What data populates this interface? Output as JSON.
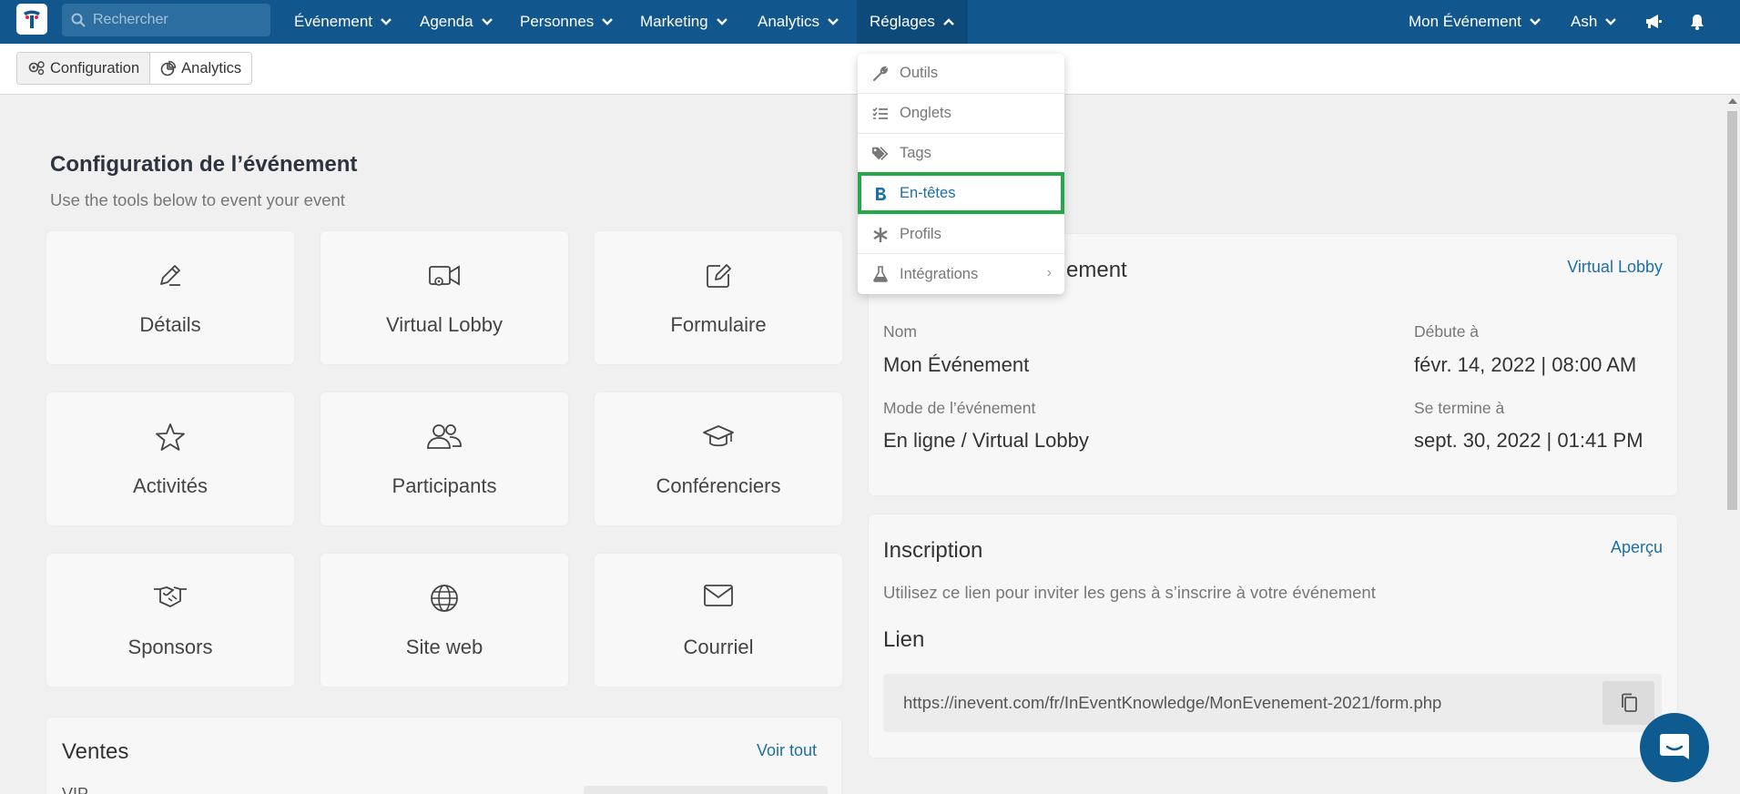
{
  "nav": {
    "search_placeholder": "Rechercher",
    "items": [
      {
        "label": "Événement"
      },
      {
        "label": "Agenda"
      },
      {
        "label": "Personnes"
      },
      {
        "label": "Marketing"
      },
      {
        "label": "Analytics"
      },
      {
        "label": "Réglages"
      }
    ],
    "event_selector": "Mon Événement",
    "user": "Ash",
    "colors": {
      "bar": "#11568c",
      "active": "#0e4a79"
    }
  },
  "subbar": {
    "configuration": "Configuration",
    "analytics": "Analytics"
  },
  "config": {
    "title": "Configuration de l’événement",
    "subtitle": "Use the tools below to event your event",
    "tiles": [
      {
        "label": "Détails",
        "icon": "pencil-icon"
      },
      {
        "label": "Virtual Lobby",
        "icon": "video-gear-icon"
      },
      {
        "label": "Formulaire",
        "icon": "edit-form-icon"
      },
      {
        "label": "Activités",
        "icon": "star-icon"
      },
      {
        "label": "Participants",
        "icon": "users-icon"
      },
      {
        "label": "Conférenciers",
        "icon": "graduation-cap-icon"
      },
      {
        "label": "Sponsors",
        "icon": "handshake-icon"
      },
      {
        "label": "Site web",
        "icon": "globe-icon"
      },
      {
        "label": "Courriel",
        "icon": "envelope-icon"
      }
    ]
  },
  "sales": {
    "title": "Ventes",
    "see_all": "Voir tout"
  },
  "event_panel": {
    "title_visible": "ement",
    "virtual_lobby_link": "Virtual Lobby",
    "name_label": "Nom",
    "name_value": "Mon Événement",
    "start_label": "Débute à",
    "start_value": "févr. 14, 2022 | 08:00 AM",
    "mode_label": "Mode de l’événement",
    "mode_value": "En ligne / Virtual Lobby",
    "end_label": "Se termine à",
    "end_value": "sept. 30, 2022 | 01:41 PM"
  },
  "inscription": {
    "title": "Inscription",
    "preview_link": "Aperçu",
    "description": "Utilisez ce lien pour inviter les gens à s’inscrire à votre événement",
    "link_label": "Lien",
    "url": "https://inevent.com/fr/InEventKnowledge/MonEvenement-2021/form.php"
  },
  "dropdown": {
    "items": [
      {
        "label": "Outils",
        "icon": "wrench-icon"
      },
      {
        "label": "Onglets",
        "icon": "list-icon"
      },
      {
        "label": "Tags",
        "icon": "tags-icon"
      },
      {
        "label": "En-têtes",
        "icon": "bold-icon"
      },
      {
        "label": "Profils",
        "icon": "asterisk-icon"
      },
      {
        "label": "Intégrations",
        "icon": "flask-icon"
      }
    ],
    "selected": "En-têtes",
    "highlight_color": "#24a84a"
  }
}
